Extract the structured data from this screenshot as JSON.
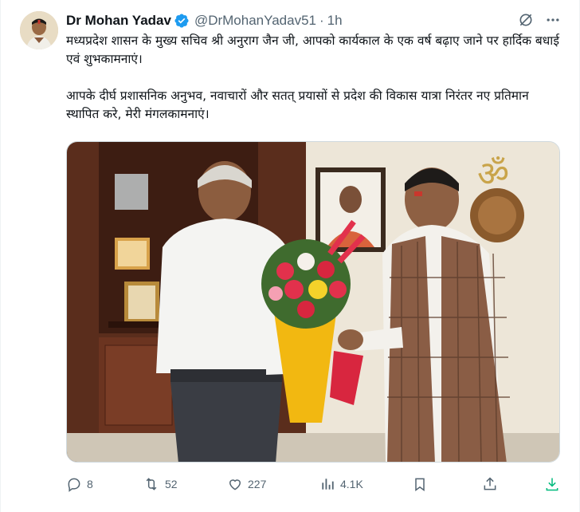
{
  "tweet": {
    "author_name": "Dr Mohan Yadav",
    "handle": "@DrMohanYadav51",
    "separator": "·",
    "time": "1h",
    "paragraph1": "मध्यप्रदेश शासन के मुख्य सचिव श्री अनुराग जैन जी, आपको कार्यकाल के एक वर्ष बढ़ाए जाने पर हार्दिक बधाई एवं शुभकामनाएं।",
    "paragraph2": "आपके दीर्घ प्रशासनिक अनुभव, नवाचारों और सतत् प्रयासों से प्रदेश की विकास यात्रा निरंतर नए प्रतिमान स्थापित करे, मेरी मंगलकामनाएं।",
    "verified_color": "#1d9bf0"
  },
  "actions": {
    "replies": "8",
    "reposts": "52",
    "likes": "227",
    "views": "4.1K"
  },
  "icons": {
    "verified": "verified-badge-icon",
    "grok": "grok-icon",
    "more": "more-icon",
    "reply": "reply-icon",
    "repost": "repost-icon",
    "like": "heart-icon",
    "views": "views-icon",
    "bookmark": "bookmark-icon",
    "share": "share-icon",
    "download": "download-icon"
  },
  "colors": {
    "text": "#0f1419",
    "secondary": "#536471",
    "accent": "#1d9bf0",
    "download": "#00ba7c"
  }
}
